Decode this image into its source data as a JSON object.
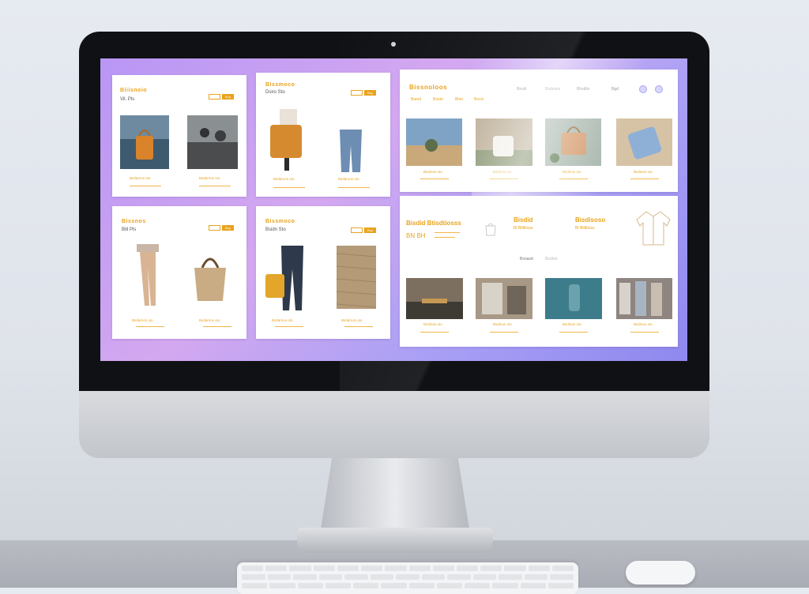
{
  "colors": {
    "accent": "#e8a31d",
    "screen_gradient_start": "#b896f5",
    "screen_gradient_end": "#8f88ee",
    "card": "#ffffff"
  },
  "cards": [
    {
      "brand": "Biiisnoio",
      "sub": "Vil. Pls",
      "btn": "Buy",
      "cap1": "Bsdarnos oto",
      "cap2": "Bsdarnos oto"
    },
    {
      "brand": "Bissmoco",
      "sub": "Dsiro Sto",
      "btn": "Buy",
      "cap1": "Bsdarnos oto",
      "cap2": "Bsdarnos oto"
    },
    {
      "brand": "Bissnos",
      "sub": "Bitl Pls",
      "btn": "Buy",
      "cap1": "Bsdarnos oto",
      "cap2": "Bsdarnos oto"
    },
    {
      "brand": "Bissmoco",
      "sub": "Bsidn Sto",
      "btn": "Buy",
      "cap1": "Bsdarnos oto",
      "cap2": "Bsdarnos oto"
    }
  ],
  "panel_top": {
    "brand": "Bissnoloos",
    "nav": [
      "Bnuiti",
      "Bsdmios",
      "Bhsdlio",
      "Bgd"
    ],
    "links": [
      "Baeot",
      "Bsoer",
      "Bloo",
      "Besis"
    ],
    "captions": [
      "Bsdmos oto",
      "Bsdmos oto",
      "Bsdmos oto",
      "Bsdmos oto"
    ]
  },
  "panel_bottom": {
    "feat1_title": "Bisdid  Btisdtiosss",
    "feat1_sub": "BN  BH",
    "feat2_title": "Bisdid",
    "feat2_sub": "Bl  Btltlbsss",
    "feat3_title": "Bisdisoso",
    "feat3_sub": "Bl  Btltlbsss",
    "tabs": [
      "Bsoasd",
      "Bsdmo"
    ],
    "captions": [
      "Bsdmos oto",
      "Bsdmos oto",
      "Bsdmos oto",
      "Bsdmos oto"
    ]
  }
}
